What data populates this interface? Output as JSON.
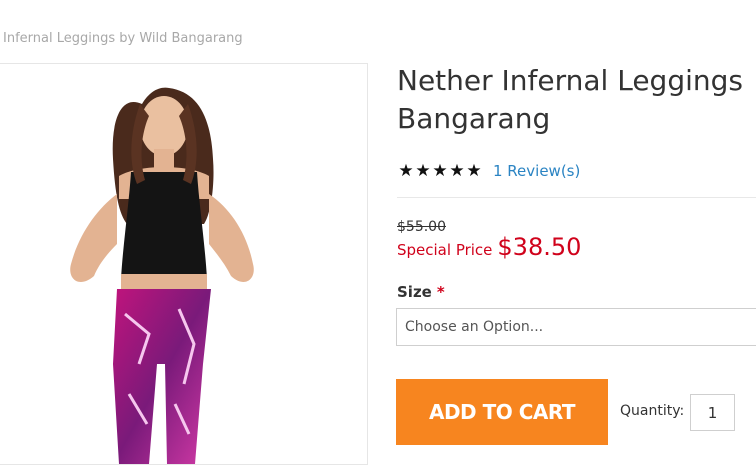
{
  "breadcrumb": {
    "current": "Infernal Leggings by Wild Bangarang"
  },
  "product": {
    "title_line1": "Nether Infernal Leggings",
    "title_line2": "Bangarang",
    "rating": {
      "stars": 5,
      "max": 5,
      "review_link": "1 Review(s)"
    },
    "old_price": "$55.00",
    "special_label": "Special Price",
    "special_price": "$38.50",
    "image_icon": "product-photo"
  },
  "options": {
    "size_label": "Size",
    "required_mark": "*",
    "size_select_value": "Choose an Option..."
  },
  "cart": {
    "add_label": "ADD TO CART",
    "quantity_label": "Quantity:",
    "quantity_value": "1"
  },
  "colors": {
    "accent_button": "#f7851f",
    "price_red": "#d0021b",
    "link_blue": "#2b84c3"
  }
}
